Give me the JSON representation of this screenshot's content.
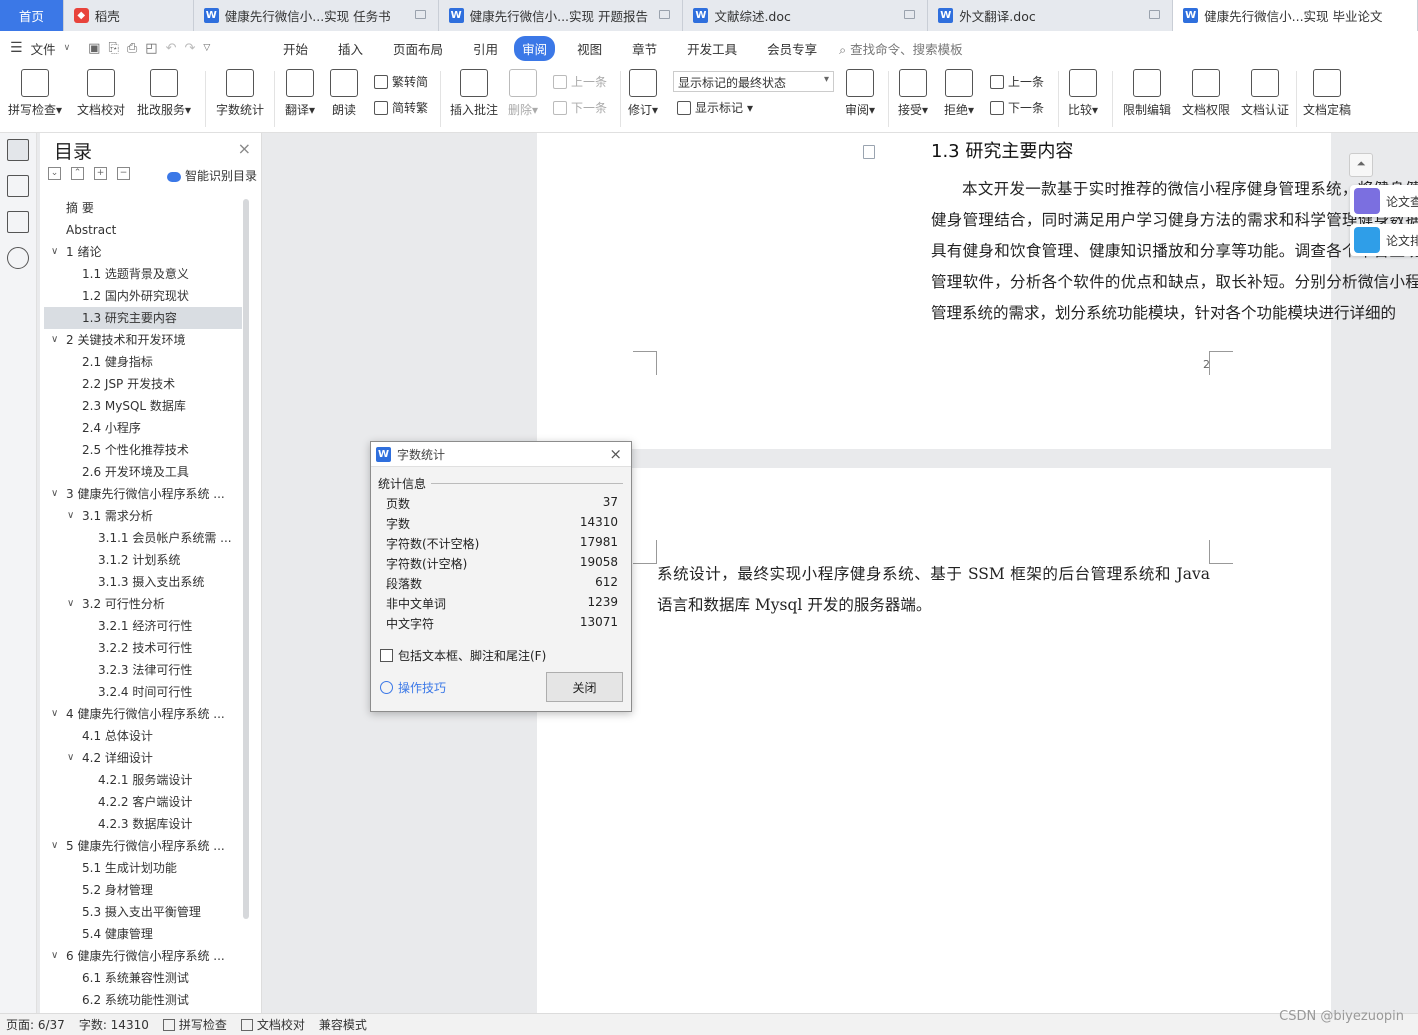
{
  "tabs": {
    "home": "首页",
    "daoke": "稻壳",
    "doc1": "健康先行微信小...实现 任务书",
    "doc2": "健康先行微信小...实现 开题报告",
    "doc3": "文献综述.doc",
    "doc4": "外文翻译.doc",
    "active": "健康先行微信小...实现 毕业论文"
  },
  "menu": {
    "file": "文件",
    "items": [
      "开始",
      "插入",
      "页面布局",
      "引用",
      "审阅",
      "视图",
      "章节",
      "开发工具",
      "会员专享"
    ],
    "active_index": 4,
    "search": "查找命令、搜索模板"
  },
  "ribbon": {
    "spell": "拼写检查",
    "proof": "文档校对",
    "batch": "批改服务",
    "wordcount": "字数统计",
    "translate": "翻译",
    "read": "朗读",
    "trad": "繁转简",
    "simp": "简转繁",
    "insert_comment": "插入批注",
    "delete": "删除",
    "prev": "上一条",
    "next": "下一条",
    "revise": "修订",
    "markup_state": "显示标记的最终状态",
    "show_markup": "显示标记",
    "review": "审阅",
    "accept": "接受",
    "reject": "拒绝",
    "prev2": "上一条",
    "next2": "下一条",
    "compare": "比较",
    "restrict": "限制编辑",
    "perm": "文档权限",
    "cert": "文档认证",
    "finalize": "文档定稿"
  },
  "toc": {
    "title": "目录",
    "smart": "智能识别目录",
    "items": [
      {
        "text": "摘  要",
        "level": 1,
        "arrow": ""
      },
      {
        "text": "Abstract",
        "level": 1,
        "arrow": ""
      },
      {
        "text": "1 绪论",
        "level": 1,
        "arrow": "v"
      },
      {
        "text": "1.1 选题背景及意义",
        "level": 2,
        "arrow": ""
      },
      {
        "text": "1.2 国内外研究现状",
        "level": 2,
        "arrow": ""
      },
      {
        "text": "1.3 研究主要内容",
        "level": 2,
        "arrow": "",
        "selected": true
      },
      {
        "text": "2 关键技术和开发环境",
        "level": 1,
        "arrow": "v"
      },
      {
        "text": "2.1 健身指标",
        "level": 2,
        "arrow": ""
      },
      {
        "text": "2.2 JSP 开发技术",
        "level": 2,
        "arrow": ""
      },
      {
        "text": "2.3 MySQL 数据库",
        "level": 2,
        "arrow": ""
      },
      {
        "text": "2.4 小程序",
        "level": 2,
        "arrow": ""
      },
      {
        "text": "2.5 个性化推荐技术",
        "level": 2,
        "arrow": ""
      },
      {
        "text": "2.6 开发环境及工具",
        "level": 2,
        "arrow": ""
      },
      {
        "text": "3 健康先行微信小程序系统 ...",
        "level": 1,
        "arrow": "v"
      },
      {
        "text": "3.1 需求分析",
        "level": 2,
        "arrow": "v"
      },
      {
        "text": "3.1.1 会员帐户系统需 ...",
        "level": 3,
        "arrow": ""
      },
      {
        "text": "3.1.2 计划系统",
        "level": 3,
        "arrow": ""
      },
      {
        "text": "3.1.3 摄入支出系统",
        "level": 3,
        "arrow": ""
      },
      {
        "text": "3.2 可行性分析",
        "level": 2,
        "arrow": "v"
      },
      {
        "text": "3.2.1 经济可行性",
        "level": 3,
        "arrow": ""
      },
      {
        "text": "3.2.2 技术可行性",
        "level": 3,
        "arrow": ""
      },
      {
        "text": "3.2.3 法律可行性",
        "level": 3,
        "arrow": ""
      },
      {
        "text": "3.2.4 时间可行性",
        "level": 3,
        "arrow": ""
      },
      {
        "text": "4 健康先行微信小程序系统 ...",
        "level": 1,
        "arrow": "v"
      },
      {
        "text": "4.1 总体设计",
        "level": 2,
        "arrow": ""
      },
      {
        "text": "4.2 详细设计",
        "level": 2,
        "arrow": "v"
      },
      {
        "text": "4.2.1 服务端设计",
        "level": 3,
        "arrow": ""
      },
      {
        "text": "4.2.2 客户端设计",
        "level": 3,
        "arrow": ""
      },
      {
        "text": "4.2.3 数据库设计",
        "level": 3,
        "arrow": ""
      },
      {
        "text": "5 健康先行微信小程序系统 ...",
        "level": 1,
        "arrow": "v"
      },
      {
        "text": "5.1 生成计划功能",
        "level": 2,
        "arrow": ""
      },
      {
        "text": "5.2 身材管理",
        "level": 2,
        "arrow": ""
      },
      {
        "text": "5.3 摄入支出平衡管理",
        "level": 2,
        "arrow": ""
      },
      {
        "text": "5.4 健康管理",
        "level": 2,
        "arrow": ""
      },
      {
        "text": "6 健康先行微信小程序系统 ...",
        "level": 1,
        "arrow": "v"
      },
      {
        "text": "6.1 系统兼容性测试",
        "level": 2,
        "arrow": ""
      },
      {
        "text": "6.2 系统功能性测试",
        "level": 2,
        "arrow": ""
      }
    ]
  },
  "document": {
    "heading": "1.3 研究主要内容",
    "para1": "本文开发一款基于实时推荐的微信小程序健身管理系统，将健身健康知识与健身管理结合，同时满足用户学习健身方法的需求和科学管理健身数据的需求。具有健身和饮食管理、健康知识播放和分享等功能。调查各个平台上现有的健康管理软件，分析各个软件的优点和缺点，取长补短。分别分析微信小程序和后台管理系统的需求，划分系统功能模块，针对各个功能模块进行详细的",
    "page_number": "2",
    "para2": "系统设计，最终实现小程序健身系统、基于 SSM 框架的后台管理系统和 Java 语言和数据库 Mysql 开发的服务器端。"
  },
  "side_float": {
    "item1": "论文查重",
    "item2": "论文排版",
    "item1_color": "#7b6fe0",
    "item2_color": "#2f9ee8"
  },
  "dialog": {
    "title": "字数统计",
    "section": "统计信息",
    "stats": [
      {
        "label": "页数",
        "value": "37"
      },
      {
        "label": "字数",
        "value": "14310"
      },
      {
        "label": "字符数(不计空格)",
        "value": "17981"
      },
      {
        "label": "字符数(计空格)",
        "value": "19058"
      },
      {
        "label": "段落数",
        "value": "612"
      },
      {
        "label": "非中文单词",
        "value": "1239"
      },
      {
        "label": "中文字符",
        "value": "13071"
      }
    ],
    "checkbox": "包括文本框、脚注和尾注(F)",
    "tips": "操作技巧",
    "close": "关闭"
  },
  "statusbar": {
    "page": "页面: 6/37",
    "words": "字数: 14310",
    "spell": "拼写检查",
    "proof": "文档校对",
    "compat": "兼容模式"
  },
  "watermark": "CSDN @biyezuopin",
  "colors": {
    "accent": "#3b78e7",
    "home_tab": "#3b78e7"
  }
}
